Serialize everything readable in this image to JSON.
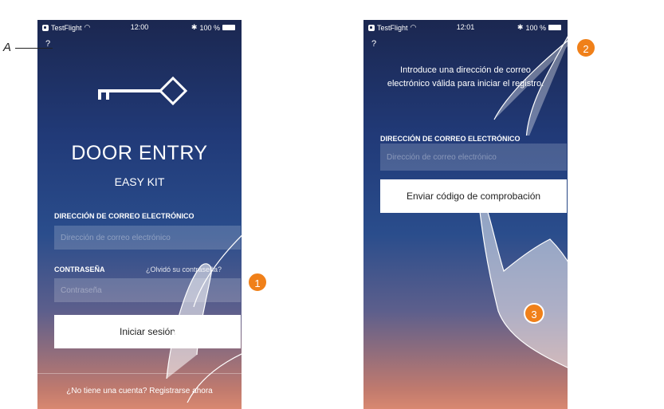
{
  "left_screen": {
    "status": {
      "carrier": "TestFlight",
      "time": "12:00",
      "battery": "100 %"
    },
    "help": "?",
    "title": "DOOR ENTRY",
    "subtitle": "EASY KIT",
    "email_label": "DIRECCIÓN DE CORREO ELECTRÓNICO",
    "email_placeholder": "Dirección de correo electrónico",
    "password_label": "CONTRASEÑA",
    "forgot_link": "¿Olvidó su contraseña?",
    "password_placeholder": "Contraseña",
    "login_button": "Iniciar sesión",
    "register_prompt": "¿No tiene una cuenta? Registrarse ahora"
  },
  "right_screen": {
    "status": {
      "carrier": "TestFlight",
      "time": "12:01",
      "battery": "100 %"
    },
    "help": "?",
    "intro": "Introduce una dirección de correo electrónico válida para iniciar el registro.",
    "email_label": "DIRECCIÓN DE CORREO ELECTRÓNICO",
    "email_placeholder": "Dirección de correo electrónico",
    "send_button": "Enviar código de comprobación"
  },
  "annotations": {
    "a_label": "A",
    "callout_1": "1",
    "callout_2": "2",
    "callout_3": "3"
  },
  "colors": {
    "callout": "#f08019",
    "background_top": "#1b2750",
    "background_bottom": "#d88870"
  },
  "icons": [
    "key-icon",
    "wifi-icon",
    "bluetooth-icon",
    "battery-icon",
    "testflight-icon",
    "hand-pointer-icon"
  ]
}
